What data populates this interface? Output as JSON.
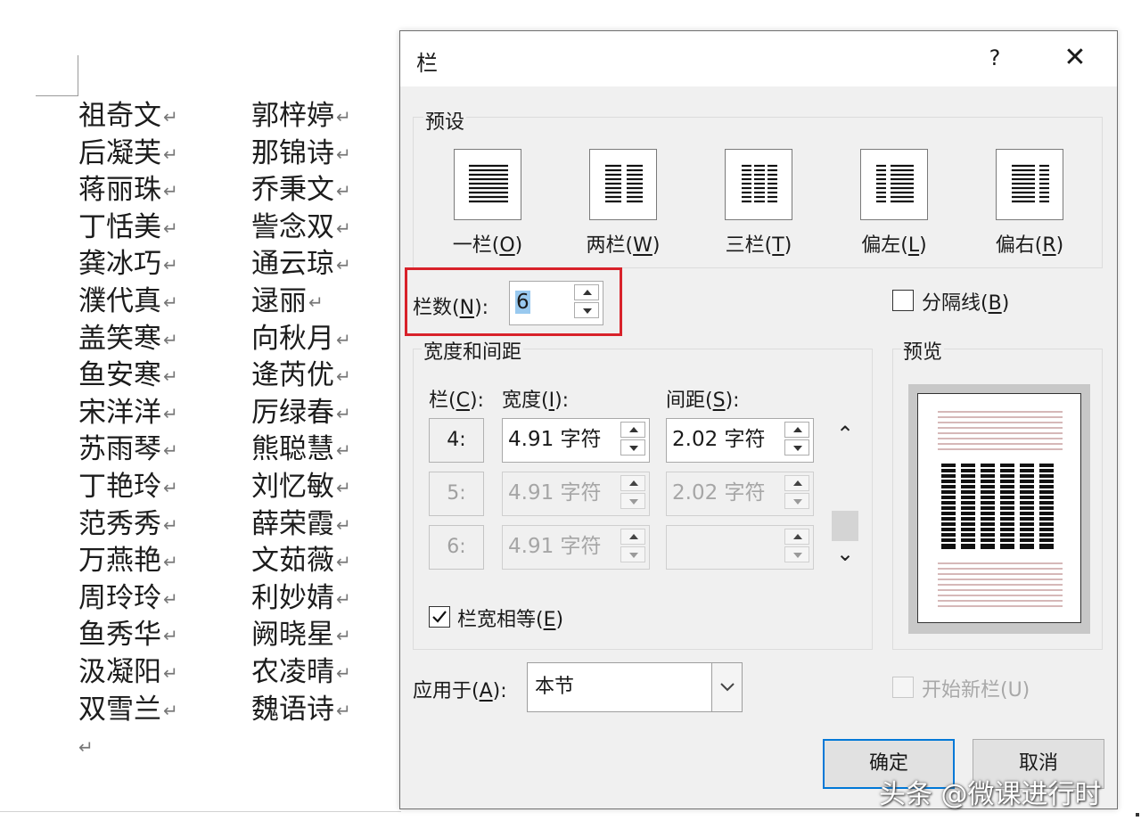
{
  "document": {
    "column1": [
      "祖奇文",
      "后凝芙",
      "蒋丽珠",
      "丁恬美",
      "龚冰巧",
      "濮代真",
      "盖笑寒",
      "鱼安寒",
      "宋洋洋",
      "苏雨琴",
      "丁艳玲",
      "范秀秀",
      "万燕艳",
      "周玲玲",
      "鱼秀华",
      "汲凝阳",
      "双雪兰"
    ],
    "column2": [
      "郭梓婷",
      "那锦诗",
      "乔秉文",
      "訾念双",
      "通云琼",
      "逯丽",
      "向秋月",
      "逄芮优",
      "厉绿春",
      "熊聪慧",
      "刘忆敏",
      "薛荣霞",
      "文茹薇",
      "利妙婧",
      "阙晓星",
      "农凌晴",
      "魏语诗"
    ],
    "paragraph_mark": "↵"
  },
  "dialog": {
    "title": "栏",
    "help": "?",
    "close": "✕",
    "presets_label": "预设",
    "presets": [
      {
        "label_pre": "一栏(",
        "key": "O",
        "label_post": ")"
      },
      {
        "label_pre": "两栏(",
        "key": "W",
        "label_post": ")"
      },
      {
        "label_pre": "三栏(",
        "key": "T",
        "label_post": ")"
      },
      {
        "label_pre": "偏左(",
        "key": "L",
        "label_post": ")"
      },
      {
        "label_pre": "偏右(",
        "key": "R",
        "label_post": ")"
      }
    ],
    "num_columns_label_pre": "栏数(",
    "num_columns_key": "N",
    "num_columns_label_post": "):",
    "num_columns_value": "6",
    "line_between_label_pre": "分隔线(",
    "line_between_key": "B",
    "line_between_label_post": ")",
    "line_between_checked": false,
    "width_spacing_label": "宽度和间距",
    "col_header_pre": "栏(",
    "col_header_key": "C",
    "col_header_post": "):",
    "width_header_pre": "宽度(",
    "width_header_key": "I",
    "width_header_post": "):",
    "spacing_header_pre": "间距(",
    "spacing_header_key": "S",
    "spacing_header_post": "):",
    "rows": [
      {
        "col": "4:",
        "width": "4.91 字符",
        "spacing": "2.02 字符",
        "enabled": true
      },
      {
        "col": "5:",
        "width": "4.91 字符",
        "spacing": "2.02 字符",
        "enabled": false
      },
      {
        "col": "6:",
        "width": "4.91 字符",
        "spacing": "",
        "enabled": false
      }
    ],
    "equal_width_label_pre": "栏宽相等(",
    "equal_width_key": "E",
    "equal_width_label_post": ")",
    "equal_width_checked": true,
    "preview_label": "预览",
    "apply_to_label_pre": "应用于(",
    "apply_to_key": "A",
    "apply_to_label_post": "):",
    "apply_to_value": "本节",
    "start_new_column_label": "开始新栏(U)",
    "ok_label": "确定",
    "cancel_label": "取消"
  },
  "watermark": "头条 @微课进行时",
  "colors": {
    "highlight_box": "#d8222a",
    "focus_border": "#0078d7",
    "selection": "#99c9ef"
  }
}
